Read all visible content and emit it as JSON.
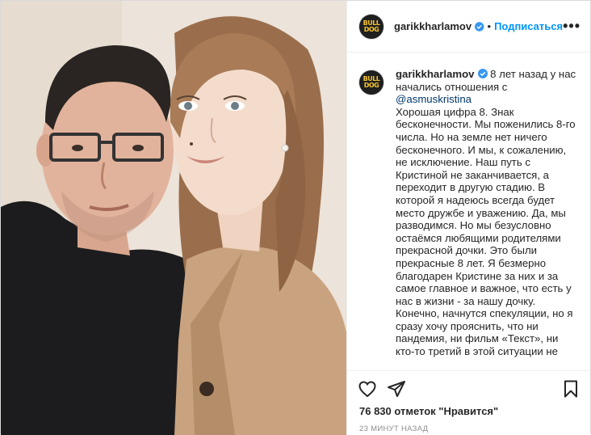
{
  "post": {
    "photo_alt": "selfie photo",
    "header": {
      "username": "garikkharlamov",
      "separator": "•",
      "follow_label": "Подписаться",
      "more_label": "•••",
      "avatar_text": "BULL DOG"
    },
    "caption": {
      "username": "garikkharlamov",
      "lead_text": " 8 лет назад у нас начались отношения с ",
      "mention": "@asmuskristina",
      "body": "Хорошая цифра 8. Знак бесконечности. Мы поженились 8-го числа. Но на земле нет ничего бесконечного. И мы, к сожалению, не исключение. Наш путь с Кристиной не заканчивается, а переходит в другую стадию. В которой я надеюсь всегда будет место дружбе и уважению. Да, мы разводимся. Но мы безусловно остаёмся любящими родителями прекрасной дочки. Это были прекрасные 8 лет. Я безмерно благодарен Кристине за них и за самое главное и важное, что есть у нас в жизни - за нашу дочку. Конечно, начнутся спекуляции, но я сразу хочу прояснить, что ни пандемия, ни фильм «Текст», ни кто-то третий в этой ситуации не"
    },
    "actions": {
      "like_icon": "heart-icon",
      "share_icon": "paper-plane-icon",
      "save_icon": "bookmark-icon"
    },
    "likes_text": "76 830 отметок \"Нравится\"",
    "time_text": "23 минут назад",
    "colors": {
      "link_blue": "#0095f6",
      "mention_blue": "#00376b",
      "verified_blue": "#3897f0",
      "muted": "#8e8e8e"
    }
  }
}
